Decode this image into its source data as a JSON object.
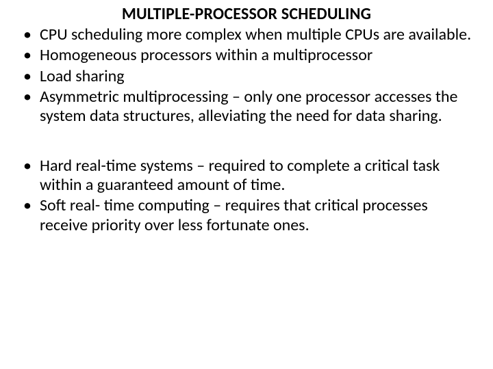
{
  "title": "MULTIPLE-PROCESSOR SCHEDULING",
  "group1": [
    "CPU scheduling more complex when multiple CPUs are available.",
    "Homogeneous processors within a multiprocessor",
    "Load sharing",
    "Asymmetric multiprocessing – only one processor accesses the system data structures, alleviating the need for data sharing."
  ],
  "group2": [
    "Hard real-time systems – required to complete a critical task within a guaranteed amount of time.",
    "Soft real- time computing – requires that critical processes receive priority over less fortunate ones."
  ]
}
